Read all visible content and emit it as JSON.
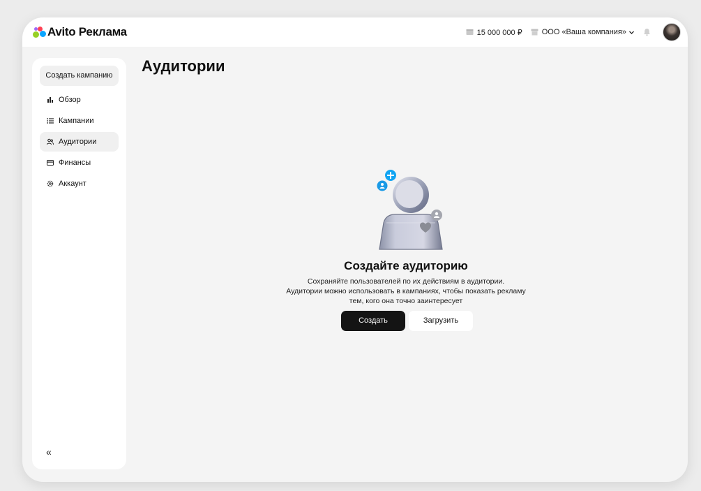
{
  "app": {
    "logo_text": "Avito Реклама",
    "brand_colors": [
      "#97cf26",
      "#0aa5ff",
      "#ff4053",
      "#a169f7"
    ]
  },
  "header": {
    "balance": "15 000 000 ₽",
    "balance_icon": "wallet-icon",
    "company": "ООО «Ваша компания»",
    "company_icon": "store-icon",
    "notification_icon": "bell-icon"
  },
  "sidebar": {
    "create_campaign_label": "Создать кампанию",
    "items": [
      {
        "label": "Обзор",
        "icon": "bar-chart-icon"
      },
      {
        "label": "Кампании",
        "icon": "list-icon"
      },
      {
        "label": "Аудитории",
        "icon": "users-icon"
      },
      {
        "label": "Финансы",
        "icon": "wallet-icon"
      },
      {
        "label": "Аккаунт",
        "icon": "gear-icon"
      }
    ],
    "active_index": 2,
    "collapse_label": "«"
  },
  "main": {
    "title": "Аудитории",
    "empty_state": {
      "title": "Создайте аудиторию",
      "description_lines": [
        "Сохраняйте пользователей по их действиям в аудитории.",
        "Аудитории можно использовать в кампаниях, чтобы показать рекламу",
        "тем, кого она точно заинтересует"
      ],
      "primary_button": "Создать",
      "secondary_button": "Загрузить"
    }
  }
}
